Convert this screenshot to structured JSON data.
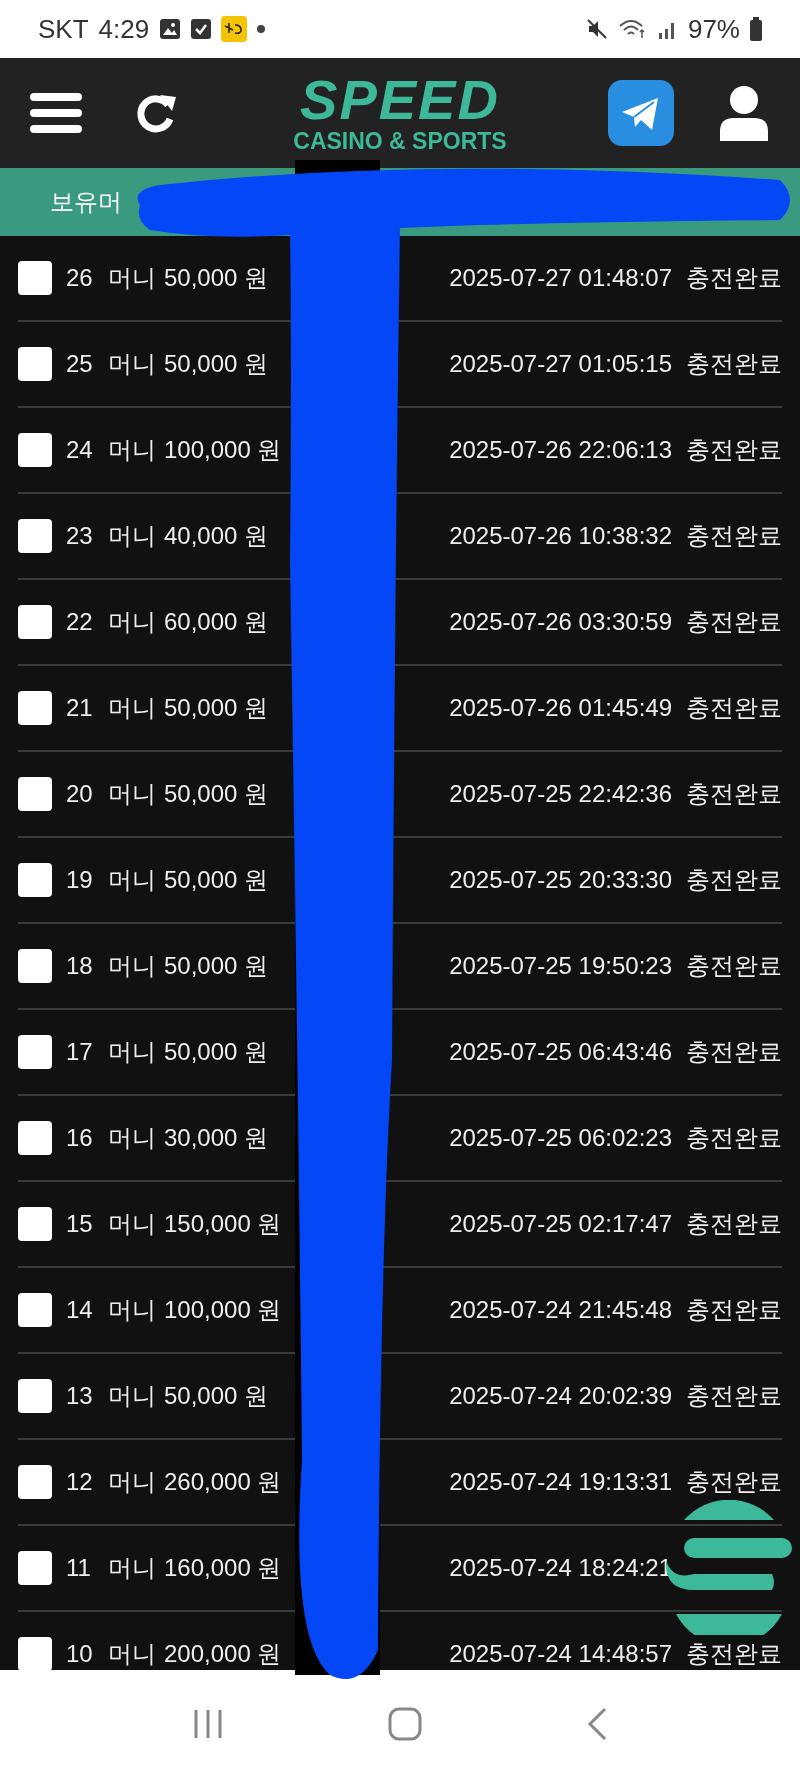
{
  "status_bar": {
    "carrier": "SKT",
    "time": "4:29",
    "battery": "97%"
  },
  "header": {
    "logo": {
      "title": "SPEED",
      "subtitle": "CASINO & SPORTS"
    }
  },
  "tab_bar": {
    "label": "보유머"
  },
  "rows": [
    {
      "number": "26",
      "type": "머니",
      "amount": "50,000 원",
      "datetime": "2025-07-27 01:48:07",
      "status": "충전완료",
      "checked": false
    },
    {
      "number": "25",
      "type": "머니",
      "amount": "50,000 원",
      "datetime": "2025-07-27 01:05:15",
      "status": "충전완료",
      "checked": false
    },
    {
      "number": "24",
      "type": "머니",
      "amount": "100,000 원",
      "datetime": "2025-07-26 22:06:13",
      "status": "충전완료",
      "checked": false
    },
    {
      "number": "23",
      "type": "머니",
      "amount": "40,000 원",
      "datetime": "2025-07-26 10:38:32",
      "status": "충전완료",
      "checked": false
    },
    {
      "number": "22",
      "type": "머니",
      "amount": "60,000 원",
      "datetime": "2025-07-26 03:30:59",
      "status": "충전완료",
      "checked": false
    },
    {
      "number": "21",
      "type": "머니",
      "amount": "50,000 원",
      "datetime": "2025-07-26 01:45:49",
      "status": "충전완료",
      "checked": false
    },
    {
      "number": "20",
      "type": "머니",
      "amount": "50,000 원",
      "datetime": "2025-07-25 22:42:36",
      "status": "충전완료",
      "checked": false
    },
    {
      "number": "19",
      "type": "머니",
      "amount": "50,000 원",
      "datetime": "2025-07-25 20:33:30",
      "status": "충전완료",
      "checked": false
    },
    {
      "number": "18",
      "type": "머니",
      "amount": "50,000 원",
      "datetime": "2025-07-25 19:50:23",
      "status": "충전완료",
      "checked": false
    },
    {
      "number": "17",
      "type": "머니",
      "amount": "50,000 원",
      "datetime": "2025-07-25 06:43:46",
      "status": "충전완료",
      "checked": false
    },
    {
      "number": "16",
      "type": "머니",
      "amount": "30,000 원",
      "datetime": "2025-07-25 06:02:23",
      "status": "충전완료",
      "checked": false
    },
    {
      "number": "15",
      "type": "머니",
      "amount": "150,000 원",
      "datetime": "2025-07-25 02:17:47",
      "status": "충전완료",
      "checked": false
    },
    {
      "number": "14",
      "type": "머니",
      "amount": "100,000 원",
      "datetime": "2025-07-24 21:45:48",
      "status": "충전완료",
      "checked": false
    },
    {
      "number": "13",
      "type": "머니",
      "amount": "50,000 원",
      "datetime": "2025-07-24 20:02:39",
      "status": "충전완료",
      "checked": false
    },
    {
      "number": "12",
      "type": "머니",
      "amount": "260,000 원",
      "datetime": "2025-07-24 19:13:31",
      "status": "충전완료",
      "checked": false
    },
    {
      "number": "11",
      "type": "머니",
      "amount": "160,000 원",
      "datetime": "2025-07-24 18:24:21",
      "checked": false
    },
    {
      "number": "10",
      "type": "머니",
      "amount": "200,000 원",
      "datetime": "2025-07-24 14:48:57",
      "status": "충전완료",
      "checked": false
    }
  ]
}
